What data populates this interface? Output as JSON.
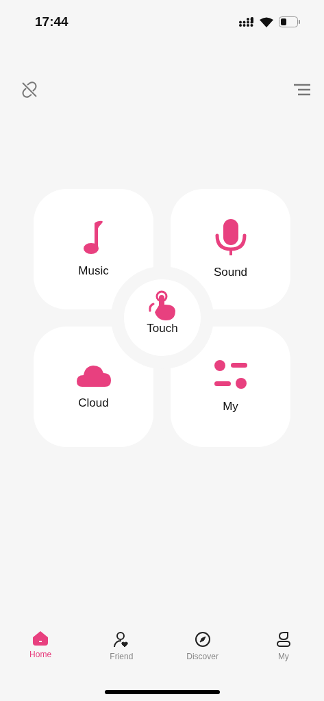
{
  "status_bar": {
    "time": "17:44"
  },
  "tiles": [
    {
      "kind": "music",
      "label": "Music"
    },
    {
      "kind": "sound",
      "label": "Sound"
    },
    {
      "kind": "cloud",
      "label": "Cloud"
    },
    {
      "kind": "my",
      "label": "My"
    }
  ],
  "center": {
    "kind": "touch",
    "label": "Touch"
  },
  "tabs": [
    {
      "kind": "home",
      "label": "Home",
      "selected": true
    },
    {
      "kind": "friend",
      "label": "Friend",
      "selected": false
    },
    {
      "kind": "discover",
      "label": "Discover",
      "selected": false
    },
    {
      "kind": "my",
      "label": "My",
      "selected": false
    }
  ]
}
